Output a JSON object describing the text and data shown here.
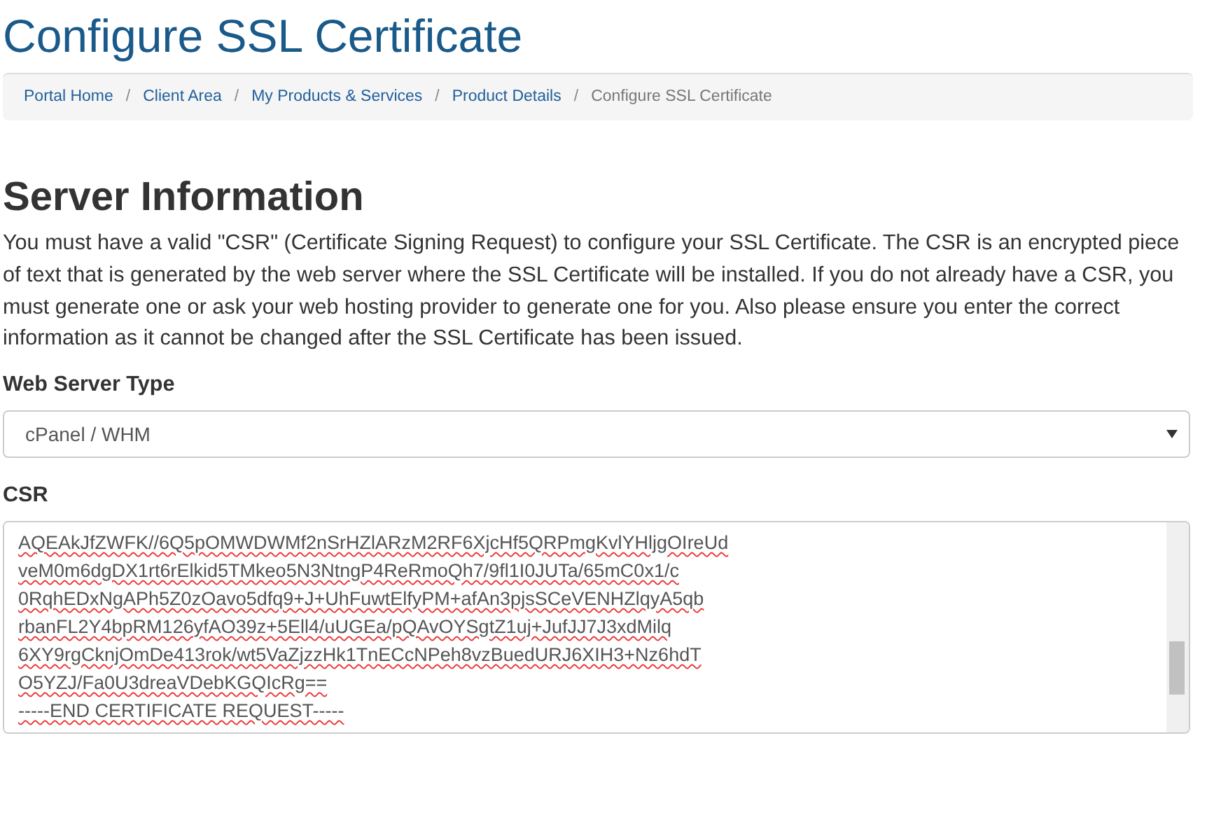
{
  "title": "Configure SSL Certificate",
  "breadcrumb_separator": "/",
  "breadcrumb": [
    {
      "label": "Portal Home",
      "active": false
    },
    {
      "label": "Client Area",
      "active": false
    },
    {
      "label": "My Products & Services",
      "active": false
    },
    {
      "label": "Product Details",
      "active": false
    },
    {
      "label": "Configure SSL Certificate",
      "active": true
    }
  ],
  "section_heading": "Server Information",
  "intro": "You must have a valid \"CSR\" (Certificate Signing Request) to configure your SSL Certificate. The CSR is an encrypted piece of text that is generated by the web server where the SSL Certificate will be installed. If you do not already have a CSR, you must generate one or ask your web hosting provider to generate one for you. Also please ensure you enter the correct information as it cannot be changed after the SSL Certificate has been issued.",
  "web_server_type": {
    "label": "Web Server Type",
    "value": "cPanel / WHM"
  },
  "csr": {
    "label": "CSR",
    "lines": [
      "AQEAkJfZWFK//6Q5pOMWDWMf2nSrHZlARzM2RF6XjcHf5QRPmgKvlYHljgOIreUd",
      "veM0m6dgDX1rt6rElkid5TMkeo5N3NtngP4ReRmoQh7/9fl1I0JUTa/65mC0x1/c",
      "0RqhEDxNgAPh5Z0zOavo5dfq9+J+UhFuwtElfyPM+afAn3pjsSCeVENHZlqyA5qb",
      "rbanFL2Y4bpRM126yfAO39z+5Ell4/uUGEa/pQAvOYSgtZ1uj+JufJJ7J3xdMilq",
      "6XY9rgCknjOmDe413rok/wt5VaZjzzHk1TnECcNPeh8vzBuedURJ6XIH3+Nz6hdT",
      "O5YZJ/Fa0U3dreaVDebKGQIcRg==",
      "-----END CERTIFICATE REQUEST-----"
    ]
  }
}
